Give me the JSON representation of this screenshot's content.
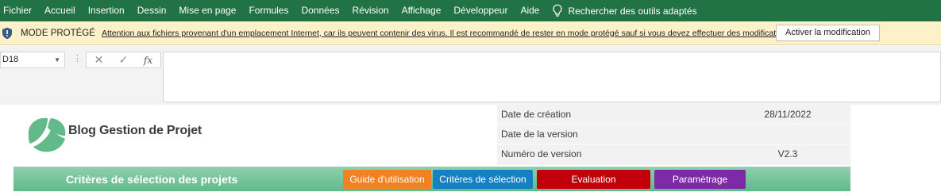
{
  "ribbon": {
    "menu": [
      "Fichier",
      "Accueil",
      "Insertion",
      "Dessin",
      "Mise en page",
      "Formules",
      "Données",
      "Révision",
      "Affichage",
      "Développeur",
      "Aide"
    ],
    "tell_me": "Rechercher des outils adaptés",
    "color": "#217346"
  },
  "protected_view": {
    "title": "MODE PROTÉGÉ",
    "message": "Attention aux fichiers provenant d'un emplacement Internet, car ils peuvent contenir des virus. Il est recommandé de rester en mode protégé sauf si vous devez effectuer des modifications.",
    "button": "Activer la modification",
    "icon": "shield-icon"
  },
  "formula_bar": {
    "cell_reference": "D18",
    "cancel_symbol": "✕",
    "enter_symbol": "✓",
    "function_symbol": "fx",
    "value": ""
  },
  "sheet": {
    "brand": "Blog Gestion de Projet",
    "meta": [
      {
        "label": "Date de création",
        "value": "28/11/2022"
      },
      {
        "label": "Date de la version",
        "value": ""
      },
      {
        "label": "Numéro de version",
        "value": "V2.3"
      }
    ],
    "band_title": "Critères de sélection des projets",
    "nav": {
      "guide": "Guide d'utilisation",
      "criteres": "Critères de sélection",
      "evaluation": "Evaluation",
      "parametrage": "Paramétrage"
    },
    "colors": {
      "band": "#62b98a",
      "guide": "#f28123",
      "criteres": "#1680c4",
      "evaluation": "#c2000b",
      "parametrage": "#7d2aa6"
    }
  }
}
